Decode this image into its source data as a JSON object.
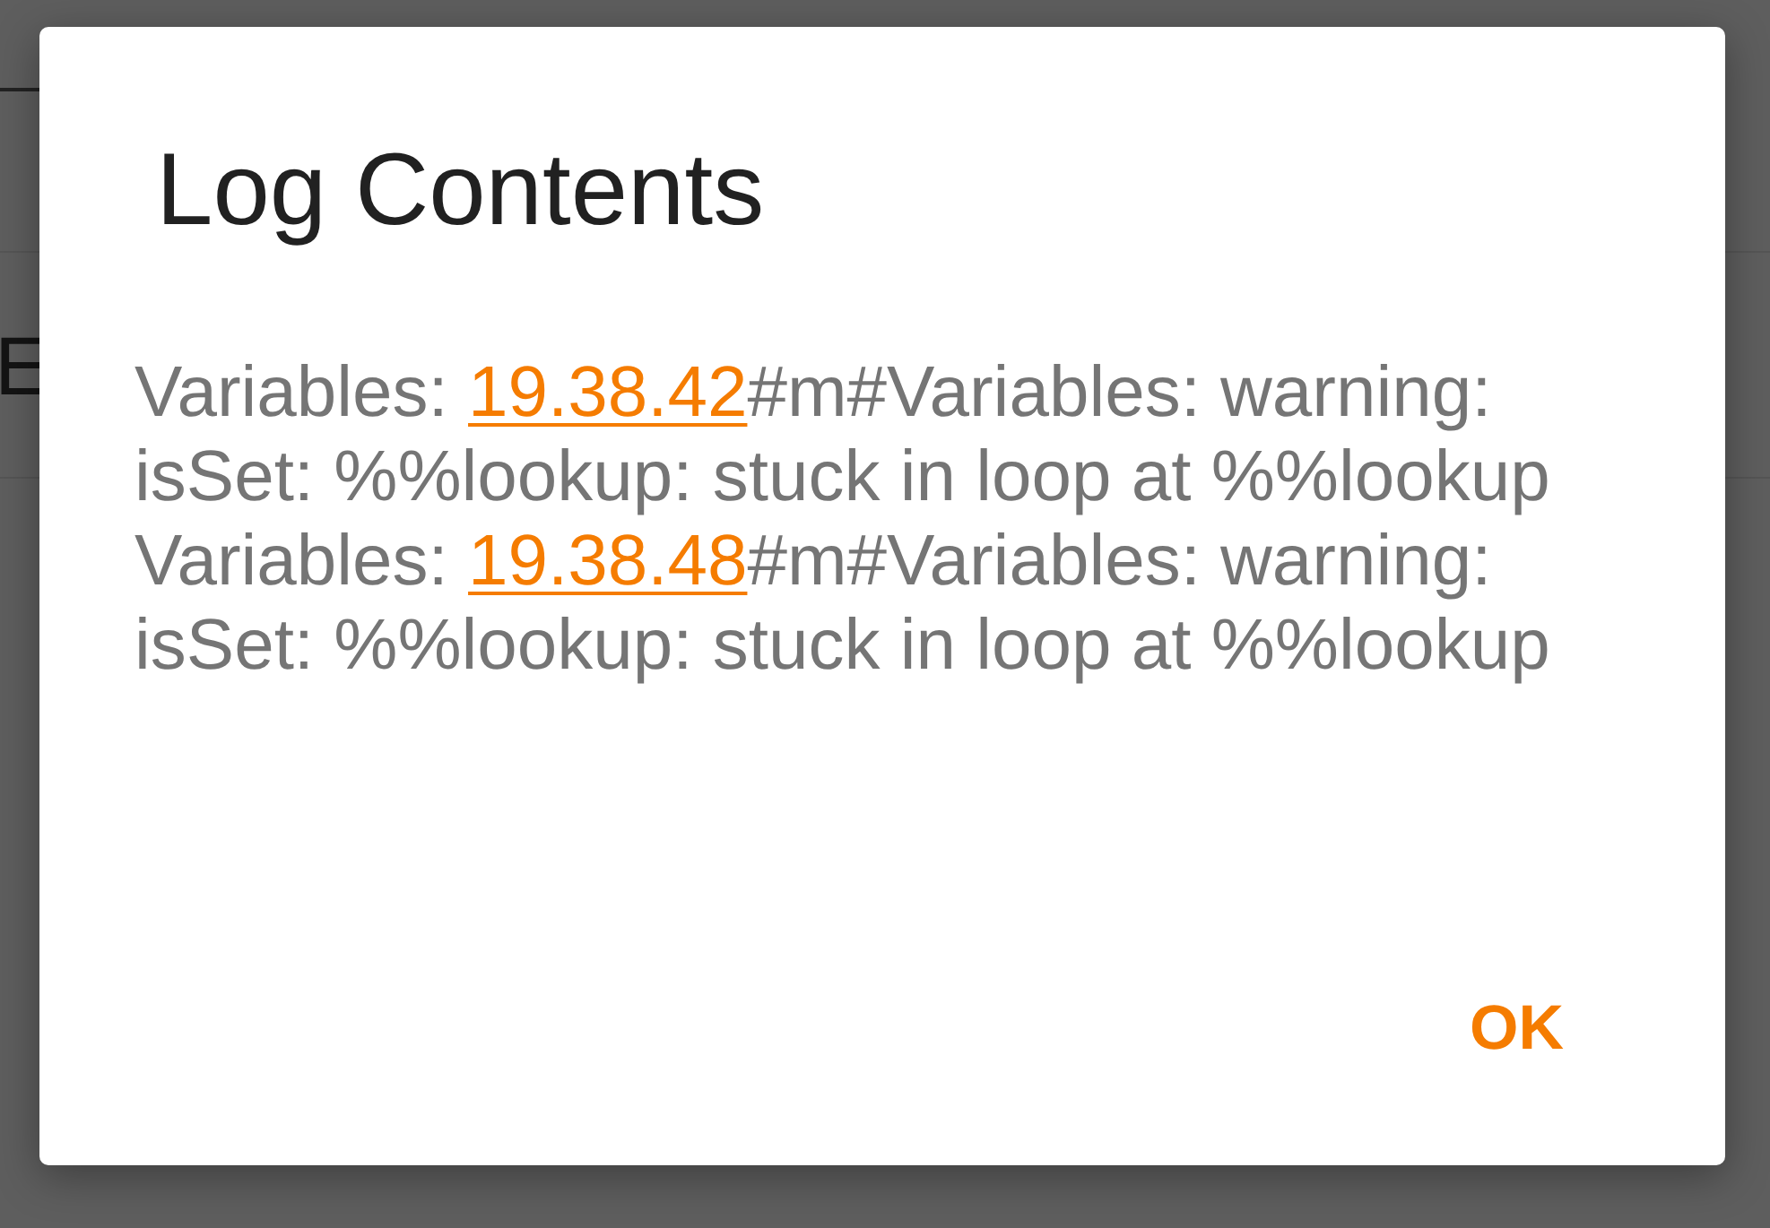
{
  "background_page": {
    "text": "E"
  },
  "dialog": {
    "title": "Log Contents",
    "entries": [
      {
        "source": "Variables: ",
        "time": "19.38.42",
        "message": "#m#Variables: warning: isSet: %%lookup: stuck in loop at %%lookup"
      },
      {
        "source": "Variables: ",
        "time": "19.38.48",
        "message": "#m#Variables: warning: isSet: %%lookup: stuck in loop at %%lookup"
      }
    ],
    "buttons": [
      {
        "label": "OK"
      }
    ]
  }
}
